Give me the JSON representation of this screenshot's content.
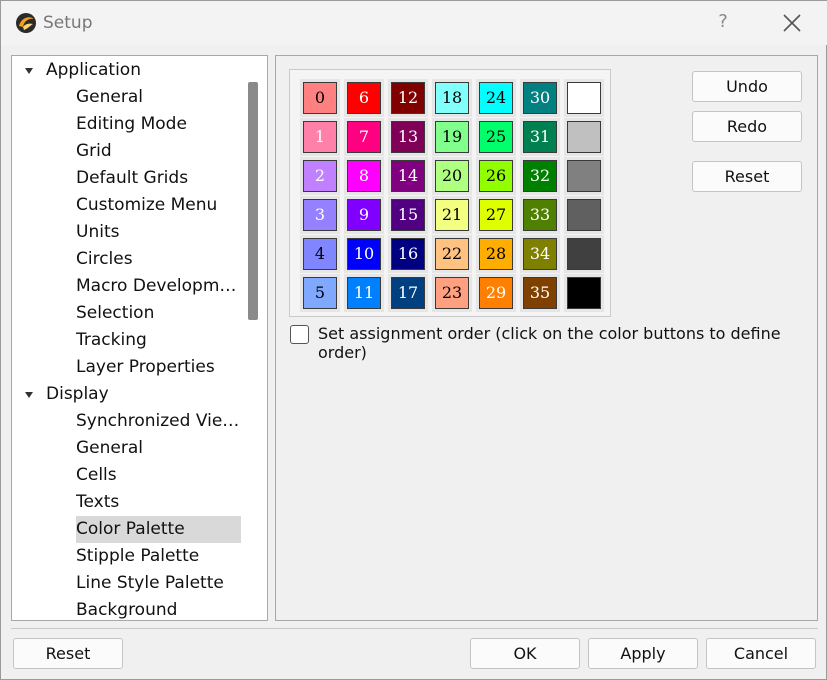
{
  "window": {
    "title": "Setup",
    "help_label": "?"
  },
  "tree": {
    "items": [
      {
        "label": "Application",
        "level": 1,
        "expanded": true
      },
      {
        "label": "General",
        "level": 2
      },
      {
        "label": "Editing Mode",
        "level": 2
      },
      {
        "label": "Grid",
        "level": 2
      },
      {
        "label": "Default Grids",
        "level": 2
      },
      {
        "label": "Customize Menu",
        "level": 2
      },
      {
        "label": "Units",
        "level": 2
      },
      {
        "label": "Circles",
        "level": 2
      },
      {
        "label": "Macro Developme...",
        "level": 2
      },
      {
        "label": "Selection",
        "level": 2
      },
      {
        "label": "Tracking",
        "level": 2
      },
      {
        "label": "Layer Properties",
        "level": 2
      },
      {
        "label": "Display",
        "level": 1,
        "expanded": true
      },
      {
        "label": "Synchronized Views",
        "level": 2
      },
      {
        "label": "General",
        "level": 2
      },
      {
        "label": "Cells",
        "level": 2
      },
      {
        "label": "Texts",
        "level": 2
      },
      {
        "label": "Color Palette",
        "level": 2,
        "selected": true
      },
      {
        "label": "Stipple Palette",
        "level": 2
      },
      {
        "label": "Line Style Palette",
        "level": 2
      },
      {
        "label": "Background",
        "level": 2
      }
    ]
  },
  "palette": {
    "columns": [
      [
        {
          "label": "0",
          "bg": "#ff8080",
          "fg": "#000000"
        },
        {
          "label": "1",
          "bg": "#ff80a8",
          "fg": "#ffffff"
        },
        {
          "label": "2",
          "bg": "#c080ff",
          "fg": "#ffffff"
        },
        {
          "label": "3",
          "bg": "#9580ff",
          "fg": "#ffffff"
        },
        {
          "label": "4",
          "bg": "#8086ff",
          "fg": "#000000"
        },
        {
          "label": "5",
          "bg": "#80a8ff",
          "fg": "#000000"
        }
      ],
      [
        {
          "label": "6",
          "bg": "#ff0000",
          "fg": "#ffffff"
        },
        {
          "label": "7",
          "bg": "#ff0080",
          "fg": "#ffffff"
        },
        {
          "label": "8",
          "bg": "#ff00ff",
          "fg": "#ffffff"
        },
        {
          "label": "9",
          "bg": "#8000ff",
          "fg": "#ffffff"
        },
        {
          "label": "10",
          "bg": "#0000ff",
          "fg": "#ffffff"
        },
        {
          "label": "11",
          "bg": "#0080ff",
          "fg": "#ffffff"
        }
      ],
      [
        {
          "label": "12",
          "bg": "#800000",
          "fg": "#ffffff"
        },
        {
          "label": "13",
          "bg": "#800057",
          "fg": "#ffffff"
        },
        {
          "label": "14",
          "bg": "#800080",
          "fg": "#ffffff"
        },
        {
          "label": "15",
          "bg": "#500080",
          "fg": "#ffffff"
        },
        {
          "label": "16",
          "bg": "#000080",
          "fg": "#ffffff"
        },
        {
          "label": "17",
          "bg": "#004080",
          "fg": "#ffffff"
        }
      ],
      [
        {
          "label": "18",
          "bg": "#80fffb",
          "fg": "#000000"
        },
        {
          "label": "19",
          "bg": "#80ff8d",
          "fg": "#000000"
        },
        {
          "label": "20",
          "bg": "#afff80",
          "fg": "#000000"
        },
        {
          "label": "21",
          "bg": "#f3ff80",
          "fg": "#000000"
        },
        {
          "label": "22",
          "bg": "#ffc280",
          "fg": "#000000"
        },
        {
          "label": "23",
          "bg": "#ffa080",
          "fg": "#000000"
        }
      ],
      [
        {
          "label": "24",
          "bg": "#00ffff",
          "fg": "#000000"
        },
        {
          "label": "25",
          "bg": "#01ff6b",
          "fg": "#000000"
        },
        {
          "label": "26",
          "bg": "#91ff00",
          "fg": "#000000"
        },
        {
          "label": "27",
          "bg": "#ddff00",
          "fg": "#000000"
        },
        {
          "label": "28",
          "bg": "#ffae00",
          "fg": "#000000"
        },
        {
          "label": "29",
          "bg": "#ff8000",
          "fg": "#ffffff"
        }
      ],
      [
        {
          "label": "30",
          "bg": "#008080",
          "fg": "#ffffff"
        },
        {
          "label": "31",
          "bg": "#008050",
          "fg": "#ffffff"
        },
        {
          "label": "32",
          "bg": "#008000",
          "fg": "#ffffff"
        },
        {
          "label": "33",
          "bg": "#508000",
          "fg": "#ffffff"
        },
        {
          "label": "34",
          "bg": "#808000",
          "fg": "#ffffff"
        },
        {
          "label": "35",
          "bg": "#804000",
          "fg": "#ffffff"
        }
      ],
      [
        {
          "label": "",
          "bg": "#ffffff",
          "fg": "#000000"
        },
        {
          "label": "",
          "bg": "#c0c0c0",
          "fg": "#000000"
        },
        {
          "label": "",
          "bg": "#808080",
          "fg": "#000000"
        },
        {
          "label": "",
          "bg": "#606060",
          "fg": "#000000"
        },
        {
          "label": "",
          "bg": "#404040",
          "fg": "#000000"
        },
        {
          "label": "",
          "bg": "#000000",
          "fg": "#000000"
        }
      ]
    ]
  },
  "palette_buttons": {
    "undo": "Undo",
    "redo": "Redo",
    "reset": "Reset"
  },
  "assignment_order": {
    "label": "Set assignment order (click on the color buttons to define order)",
    "checked": false
  },
  "footer": {
    "reset": "Reset",
    "ok": "OK",
    "apply": "Apply",
    "cancel": "Cancel"
  }
}
